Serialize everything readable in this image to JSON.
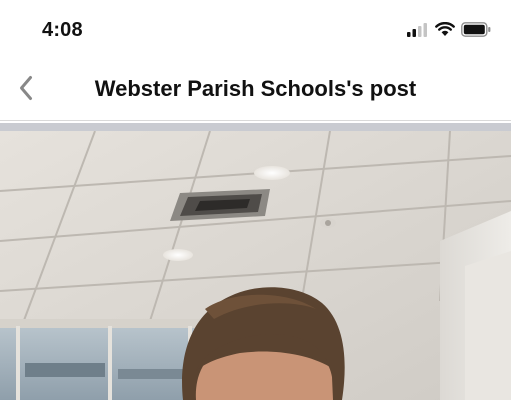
{
  "status_bar": {
    "time": "4:08",
    "icons": [
      "cellular-signal-icon",
      "wifi-icon",
      "battery-icon"
    ]
  },
  "nav": {
    "back_icon": "chevron-left-icon",
    "title": "Webster Parish Schools's post"
  },
  "colors": {
    "background": "#ffffff",
    "text": "#111111",
    "back_chevron": "#888888",
    "separator_band": "#c9cbd1"
  }
}
